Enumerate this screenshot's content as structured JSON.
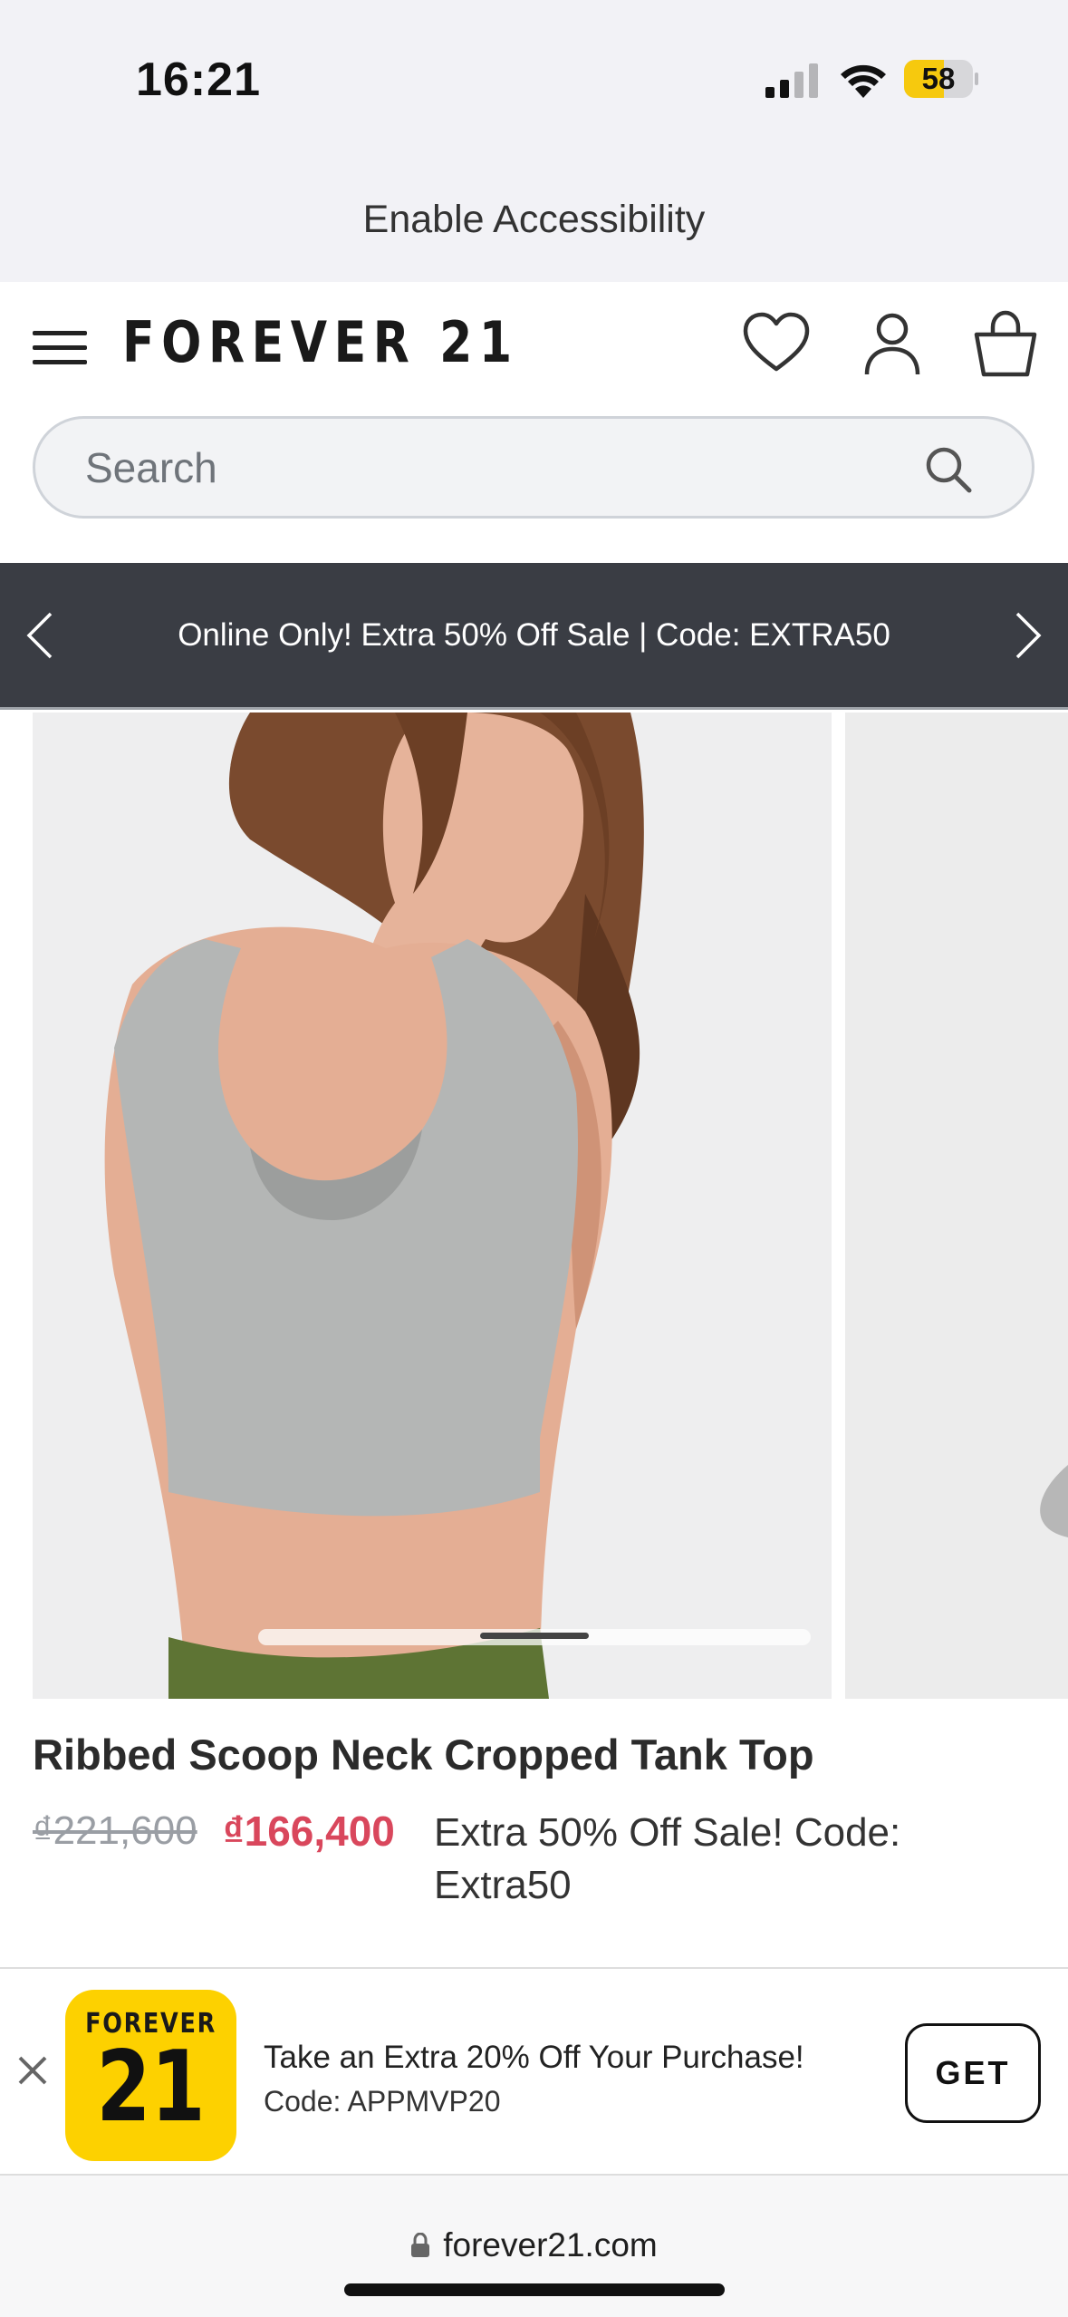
{
  "status_bar": {
    "time": "16:21",
    "battery_percent": "58",
    "battery_level": 0.58
  },
  "accessibility": {
    "label": "Enable Accessibility"
  },
  "header": {
    "logo": "FOREVER 21"
  },
  "search": {
    "placeholder": "Search"
  },
  "promo_banner": {
    "text": "Online Only! Extra 50% Off Sale | Code: EXTRA50"
  },
  "product": {
    "title": "Ribbed Scoop Neck Cropped Tank Top",
    "original_price": "₫221,600",
    "sale_price": "₫166,400",
    "promo_note": "Extra 50% Off Sale! Code: Extra50"
  },
  "app_banner": {
    "logo_top": "FOREVER",
    "logo_number": "21",
    "title": "Take an Extra 20% Off Your Purchase!",
    "subtitle": "Code: APPMVP20",
    "get_label": "GET"
  },
  "browser": {
    "url": "forever21.com"
  },
  "colors": {
    "promo_bg": "#3a3d44",
    "sale_price": "#d9475c",
    "app_logo_bg": "#fdd100",
    "battery_fill": "#f6c90e"
  }
}
